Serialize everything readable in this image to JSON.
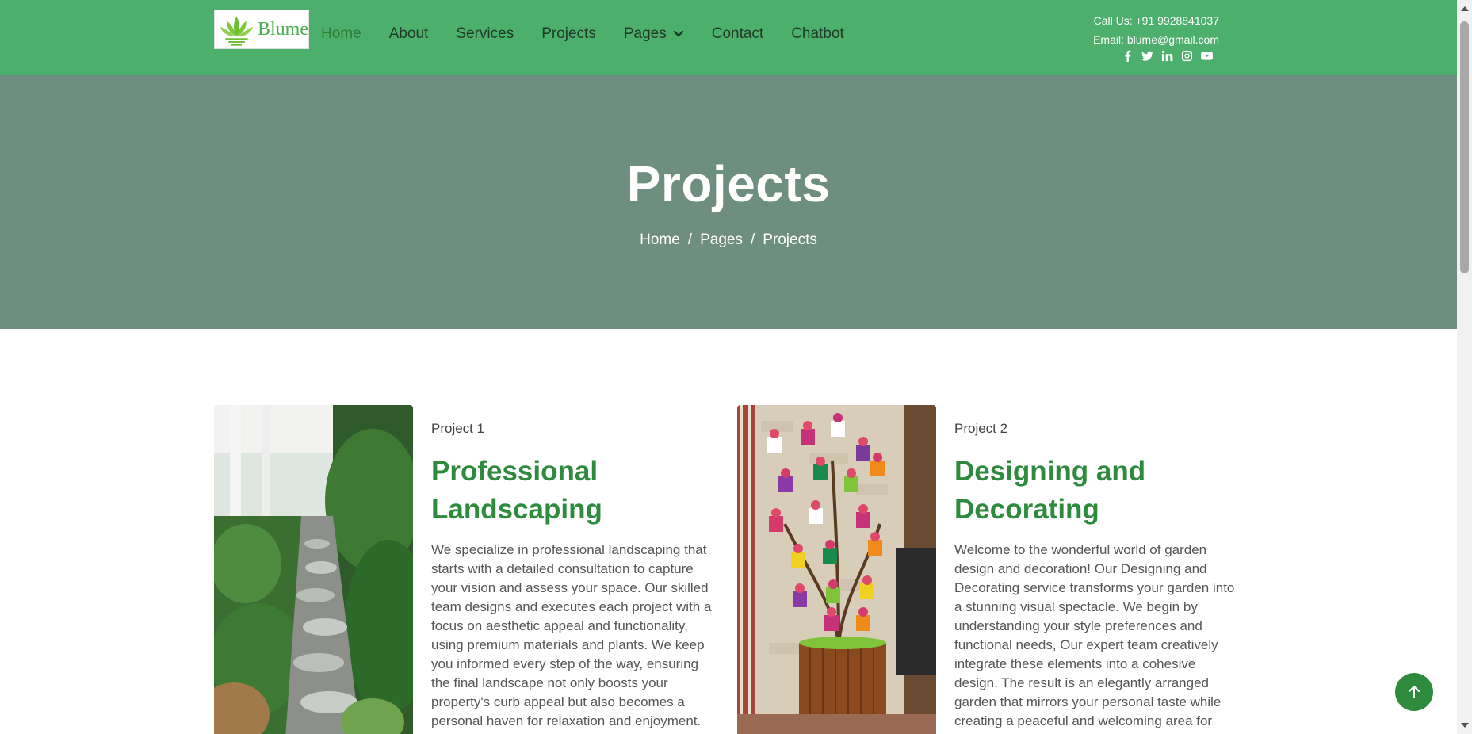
{
  "header": {
    "logo_text": "Blume",
    "nav": [
      {
        "label": "Home",
        "active": true
      },
      {
        "label": "About"
      },
      {
        "label": "Services"
      },
      {
        "label": "Projects"
      },
      {
        "label": "Pages",
        "dropdown": true
      },
      {
        "label": "Contact"
      },
      {
        "label": "Chatbot"
      }
    ],
    "call": "Call Us: +91 9928841037",
    "email": "Email: blume@gmail.com",
    "socials": [
      "facebook-icon",
      "twitter-icon",
      "linkedin-icon",
      "instagram-icon",
      "youtube-icon"
    ]
  },
  "hero": {
    "title": "Projects",
    "breadcrumb": [
      "Home",
      "Pages",
      "Projects"
    ],
    "separator": "/"
  },
  "projects": [
    {
      "number": "Project 1",
      "title_line1": "Professional",
      "title_line2": "Landscaping",
      "description": "We specialize in professional landscaping that starts with a detailed consultation to capture your vision and assess your space. Our skilled team designs and executes each project with a focus on aesthetic appeal and functionality, using premium materials and plants. We keep you informed every step of the way, ensuring the final landscape not only boosts your property's curb appeal but also becomes a personal haven for relaxation and enjoyment."
    },
    {
      "number": "Project 2",
      "title_line1": "Designing and",
      "title_line2": "Decorating",
      "description": "Welcome to the wonderful world of garden design and decoration! Our Designing and Decorating service transforms your garden into a stunning visual spectacle. We begin by understanding your style preferences and functional needs, Our expert team creatively integrate these elements into a cohesive design. The result is an elegantly arranged garden that mirrors your personal taste while creating a peaceful and welcoming area for your pleasure."
    }
  ],
  "colors": {
    "header_bg": "#4caf6c",
    "hero_bg": "#6e8f80",
    "accent": "#2e8b3e",
    "active_nav": "#2e7d32"
  }
}
